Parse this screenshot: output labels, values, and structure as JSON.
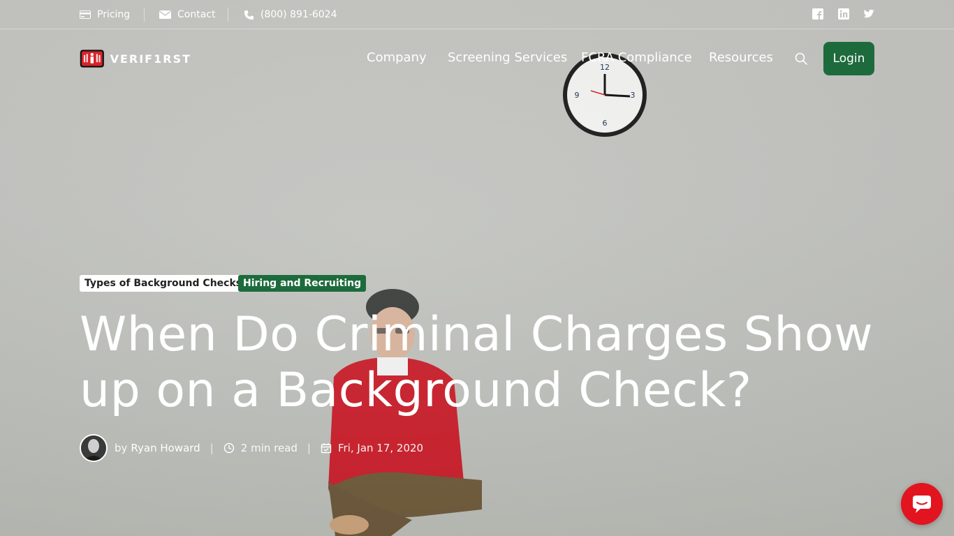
{
  "topbar": {
    "pricing_label": "Pricing",
    "contact_label": "Contact",
    "phone_label": "(800) 891-6024",
    "social": [
      "facebook-icon",
      "linkedin-icon",
      "twitter-icon"
    ]
  },
  "header": {
    "logo_text": "VERIF1RST",
    "nav": {
      "company": "Company",
      "screening": "Screening Services",
      "fcra": "FCRA Compliance",
      "resources": "Resources"
    },
    "login_label": "Login"
  },
  "article": {
    "tags": {
      "tag1": "Types of Background Checks",
      "tag2": "Hiring and Recruiting"
    },
    "title": "When Do Criminal Charges Show up on a Background Check?",
    "meta": {
      "by": "by",
      "author": "Ryan Howard",
      "read_time": "2 min read",
      "date": "Fri, Jan 17, 2020"
    }
  },
  "colors": {
    "brand_green": "#1d6b3c",
    "chat_red": "#e2141f"
  }
}
